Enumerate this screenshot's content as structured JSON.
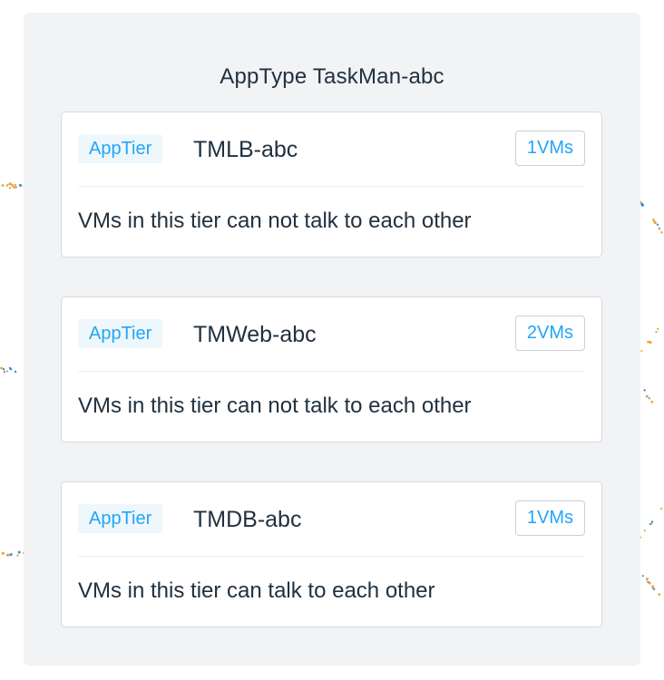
{
  "app_type": {
    "title": "AppType TaskMan-abc"
  },
  "tiers": [
    {
      "badge": "AppTier",
      "name": "TMLB-abc",
      "vm_count": "1VMs",
      "policy": "VMs in this tier can not talk to each other"
    },
    {
      "badge": "AppTier",
      "name": "TMWeb-abc",
      "vm_count": "2VMs",
      "policy": "VMs in this tier can not talk to each other"
    },
    {
      "badge": "AppTier",
      "name": "TMDB-abc",
      "vm_count": "1VMs",
      "policy": "VMs in this tier can talk to each other"
    }
  ],
  "colors": {
    "panel_bg": "#f2f3f5",
    "card_border": "#d5dadf",
    "accent_blue": "#22a5f7",
    "badge_bg": "#eef7fc",
    "text_dark": "#22313f",
    "flow_orange": "#e8a33c",
    "flow_blue": "#2d8fd8"
  }
}
